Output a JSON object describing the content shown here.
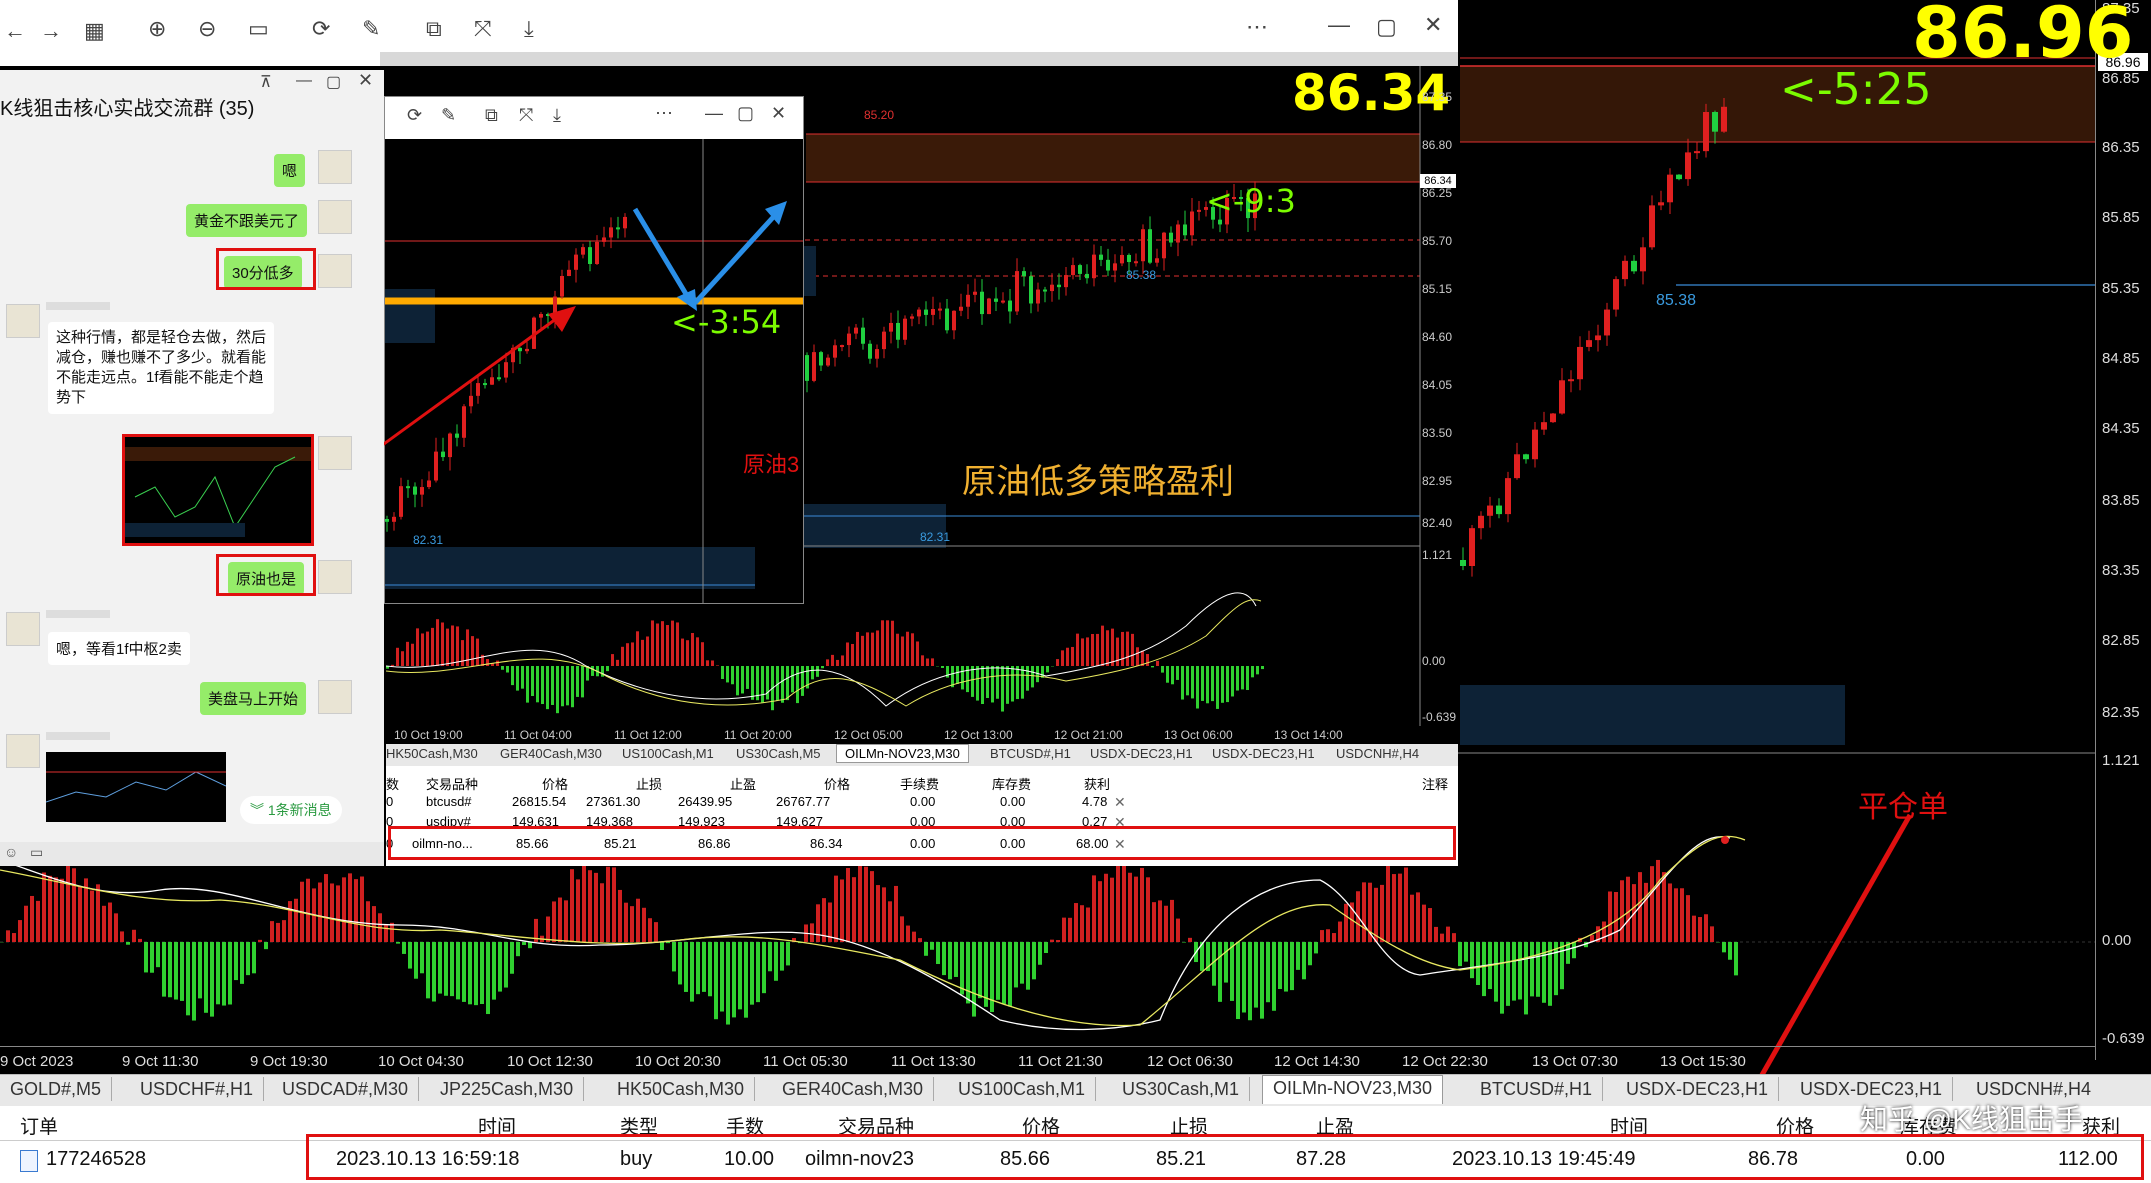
{
  "main_chart": {
    "price_labels": [
      "87.35",
      "86.85",
      "86.35",
      "85.85",
      "85.35",
      "84.85",
      "84.35",
      "83.85",
      "83.35",
      "82.85",
      "82.35"
    ],
    "current_price_tag": "86.96",
    "big_price": "86.96",
    "timer": "<-5:25",
    "level_label": "85.38",
    "indicator_labels": [
      "1.121",
      "0.00",
      "-0.639"
    ],
    "time_labels": [
      "9 Oct 2023",
      "9 Oct 11:30",
      "9 Oct 19:30",
      "10 Oct 04:30",
      "10 Oct 12:30",
      "10 Oct 20:30",
      "11 Oct 05:30",
      "11 Oct 13:30",
      "11 Oct 21:30",
      "12 Oct 06:30",
      "12 Oct 14:30",
      "12 Oct 22:30",
      "13 Oct 07:30",
      "13 Oct 15:30"
    ],
    "annotation_close_order": "平仓单"
  },
  "bottom_tabs": [
    "GOLD#,M5",
    "USDCHF#,H1",
    "USDCAD#,M30",
    "JP225Cash,M30",
    "HK50Cash,M30",
    "GER40Cash,M30",
    "US100Cash,M1",
    "US30Cash,M1",
    "OILMn-NOV23,M30",
    "BTCUSD#,H1",
    "USDX-DEC23,H1",
    "USDX-DEC23,H1",
    "USDCNH#,H4"
  ],
  "bottom_active_tab": "OILMn-NOV23,M30",
  "order_table": {
    "headers": [
      "订单",
      "时间",
      "类型",
      "手数",
      "交易品种",
      "价格",
      "止损",
      "止盈",
      "时间",
      "价格",
      "库存费",
      "获利"
    ],
    "row": [
      "177246528",
      "2023.10.13 16:59:18",
      "buy",
      "10.00",
      "oilmn-nov23",
      "85.66",
      "85.21",
      "87.28",
      "2023.10.13 19:45:49",
      "86.78",
      "0.00",
      "112.00"
    ]
  },
  "watermark": "知乎 @K线狙击手",
  "mt_window": {
    "big_price": "86.34",
    "timer": "<-9:3",
    "price_labels": [
      "87.35",
      "86.80",
      "86.25",
      "85.70",
      "85.15",
      "84.60",
      "84.05",
      "83.50",
      "82.95",
      "82.40"
    ],
    "price_tag": "86.34",
    "top_level": "85.20",
    "level_label": "85.38",
    "low_label": "82.31",
    "caption": "原油低多策略盈利",
    "indicator_labels": [
      "1.121",
      "0.00",
      "-0.639"
    ],
    "time_labels": [
      "10 Oct 19:00",
      "11 Oct 04:00",
      "11 Oct 12:00",
      "11 Oct 20:00",
      "12 Oct 05:00",
      "12 Oct 13:00",
      "12 Oct 21:00",
      "13 Oct 06:00",
      "13 Oct 14:00"
    ],
    "tabs": [
      "HK50Cash,M30",
      "GER40Cash,M30",
      "US100Cash,M1",
      "US30Cash,M5",
      "OILMn-NOV23,M30",
      "BTCUSD#,H1",
      "USDX-DEC23,H1",
      "USDX-DEC23,H1",
      "USDCNH#,H4"
    ],
    "active_tab": "OILMn-NOV23,M30",
    "table_headers": [
      "数",
      "交易品种",
      "价格",
      "止损",
      "止盈",
      "价格",
      "手续费",
      "库存费",
      "获利",
      "注释"
    ],
    "table_rows": [
      [
        "0",
        "btcusd#",
        "26815.54",
        "27361.30",
        "26439.95",
        "26767.77",
        "0.00",
        "0.00",
        "4.78"
      ],
      [
        "0",
        "usdjpy#",
        "149.631",
        "149.368",
        "149.923",
        "149.627",
        "0.00",
        "0.00",
        "0.27"
      ],
      [
        "0",
        "oilmn-no...",
        "85.66",
        "85.21",
        "86.86",
        "86.34",
        "0.00",
        "0.00",
        "68.00"
      ]
    ]
  },
  "small_window": {
    "timer": "<-3:54",
    "low_label": "82.31",
    "label": "原油3"
  },
  "chat": {
    "title": "K线狙击核心实战交流群 (35)",
    "messages": [
      {
        "side": "right",
        "text": "嗯"
      },
      {
        "side": "right",
        "text": "黄金不跟美元了"
      },
      {
        "side": "right",
        "text": "30分低多"
      },
      {
        "side": "left",
        "text": "这种行情，都是轻仓去做，然后减仓，赚也赚不了多少。就看能不能走远点。1f看能不能走个趋势下"
      },
      {
        "side": "right",
        "text": "原油也是"
      },
      {
        "side": "left",
        "text": "嗯，等看1f中枢2卖"
      },
      {
        "side": "right",
        "text": "美盘马上开始"
      }
    ],
    "new_message_badge": "1条新消息"
  }
}
